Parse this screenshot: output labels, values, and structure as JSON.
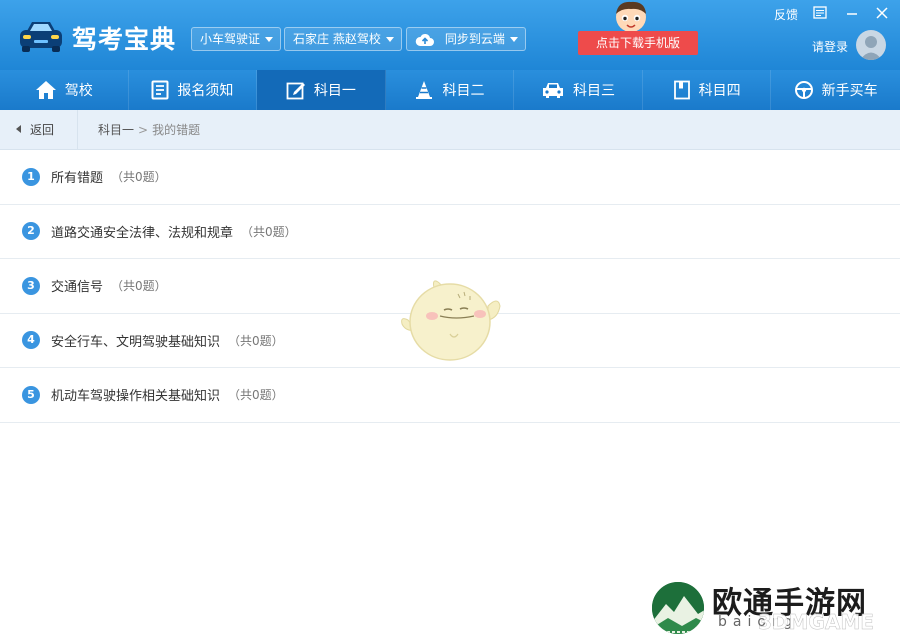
{
  "header": {
    "app_title": "驾考宝典",
    "license_dropdown": "小车驾驶证",
    "school_dropdown": "石家庄 燕赵驾校",
    "sync_dropdown": "同步到云端",
    "download_button": "点击下载手机版",
    "feedback": "反馈",
    "login": "请登录"
  },
  "nav": {
    "items": [
      {
        "label": "驾校",
        "icon": "home-icon"
      },
      {
        "label": "报名须知",
        "icon": "document-icon"
      },
      {
        "label": "科目一",
        "icon": "edit-icon"
      },
      {
        "label": "科目二",
        "icon": "cone-icon"
      },
      {
        "label": "科目三",
        "icon": "car-icon"
      },
      {
        "label": "科目四",
        "icon": "book-icon"
      },
      {
        "label": "新手买车",
        "icon": "steering-wheel-icon"
      }
    ],
    "active_index": 2
  },
  "breadcrumb": {
    "back": "返回",
    "level1": "科目一",
    "separator": ">",
    "level2": "我的错题"
  },
  "list": {
    "items": [
      {
        "num": "1",
        "label": "所有错题",
        "count": "（共0题）"
      },
      {
        "num": "2",
        "label": "道路交通安全法律、法规和规章",
        "count": "（共0题）"
      },
      {
        "num": "3",
        "label": "交通信号",
        "count": "（共0题）"
      },
      {
        "num": "4",
        "label": "安全行车、文明驾驶基础知识",
        "count": "（共0题）"
      },
      {
        "num": "5",
        "label": "机动车驾驶操作相关基础知识",
        "count": "（共0题）"
      }
    ]
  },
  "watermark": {
    "name": "欧通手游网",
    "sub": "baiorg",
    "brand": "3DMGAME"
  },
  "colors": {
    "header": "#2b93df",
    "nav_active": "#136ab8",
    "download": "#ee4b4b",
    "number_badge": "#3a95e0"
  }
}
